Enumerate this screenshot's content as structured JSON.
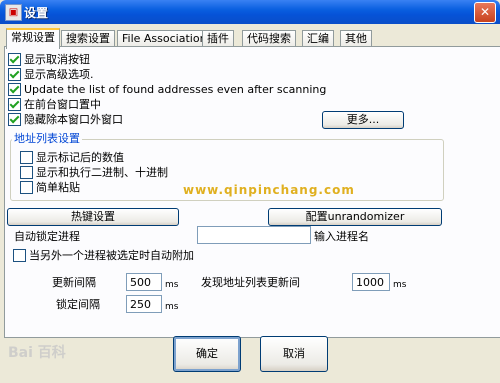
{
  "window": {
    "title": "设置",
    "close": "✕"
  },
  "tabs": [
    "常规设置",
    "搜索设置",
    "File Associations",
    "插件",
    "代码搜索",
    "汇编",
    "其他"
  ],
  "general": {
    "checkboxes": [
      {
        "label": "显示取消按钮",
        "checked": true
      },
      {
        "label": "显示高级选项.",
        "checked": true
      },
      {
        "label": "Update the list of found addresses even after scanning",
        "checked": true
      },
      {
        "label": "在前台窗口置中",
        "checked": true
      },
      {
        "label": "隐藏除本窗口外窗口",
        "checked": true
      }
    ],
    "more_button": "更多..."
  },
  "address_list": {
    "group_label": "地址列表设置",
    "checkboxes": [
      {
        "label": "显示标记后的数值",
        "checked": false
      },
      {
        "label": "显示和执行二进制、十进制",
        "checked": false
      },
      {
        "label": "简单粘贴",
        "checked": false
      }
    ]
  },
  "watermark": "www.qinpinchang.com",
  "hotkey_button": "热键设置",
  "unrandomizer_button": "配置unrandomizer",
  "auto_attach": {
    "label": "自动锁定进程",
    "input_value": "",
    "hint": "输入进程名",
    "checkbox_label": "当另外一个进程被选定时自动附加",
    "checked": false
  },
  "intervals": {
    "update_label": "更新间隔",
    "update_value": "500",
    "update_unit": "ms",
    "found_label": "发现地址列表更新间",
    "found_value": "1000",
    "found_unit": "ms",
    "freeze_label": "锁定间隔",
    "freeze_value": "250",
    "freeze_unit": "ms"
  },
  "footer": {
    "ok": "确定",
    "cancel": "取消",
    "baidu_watermark": "Bai 百科"
  }
}
